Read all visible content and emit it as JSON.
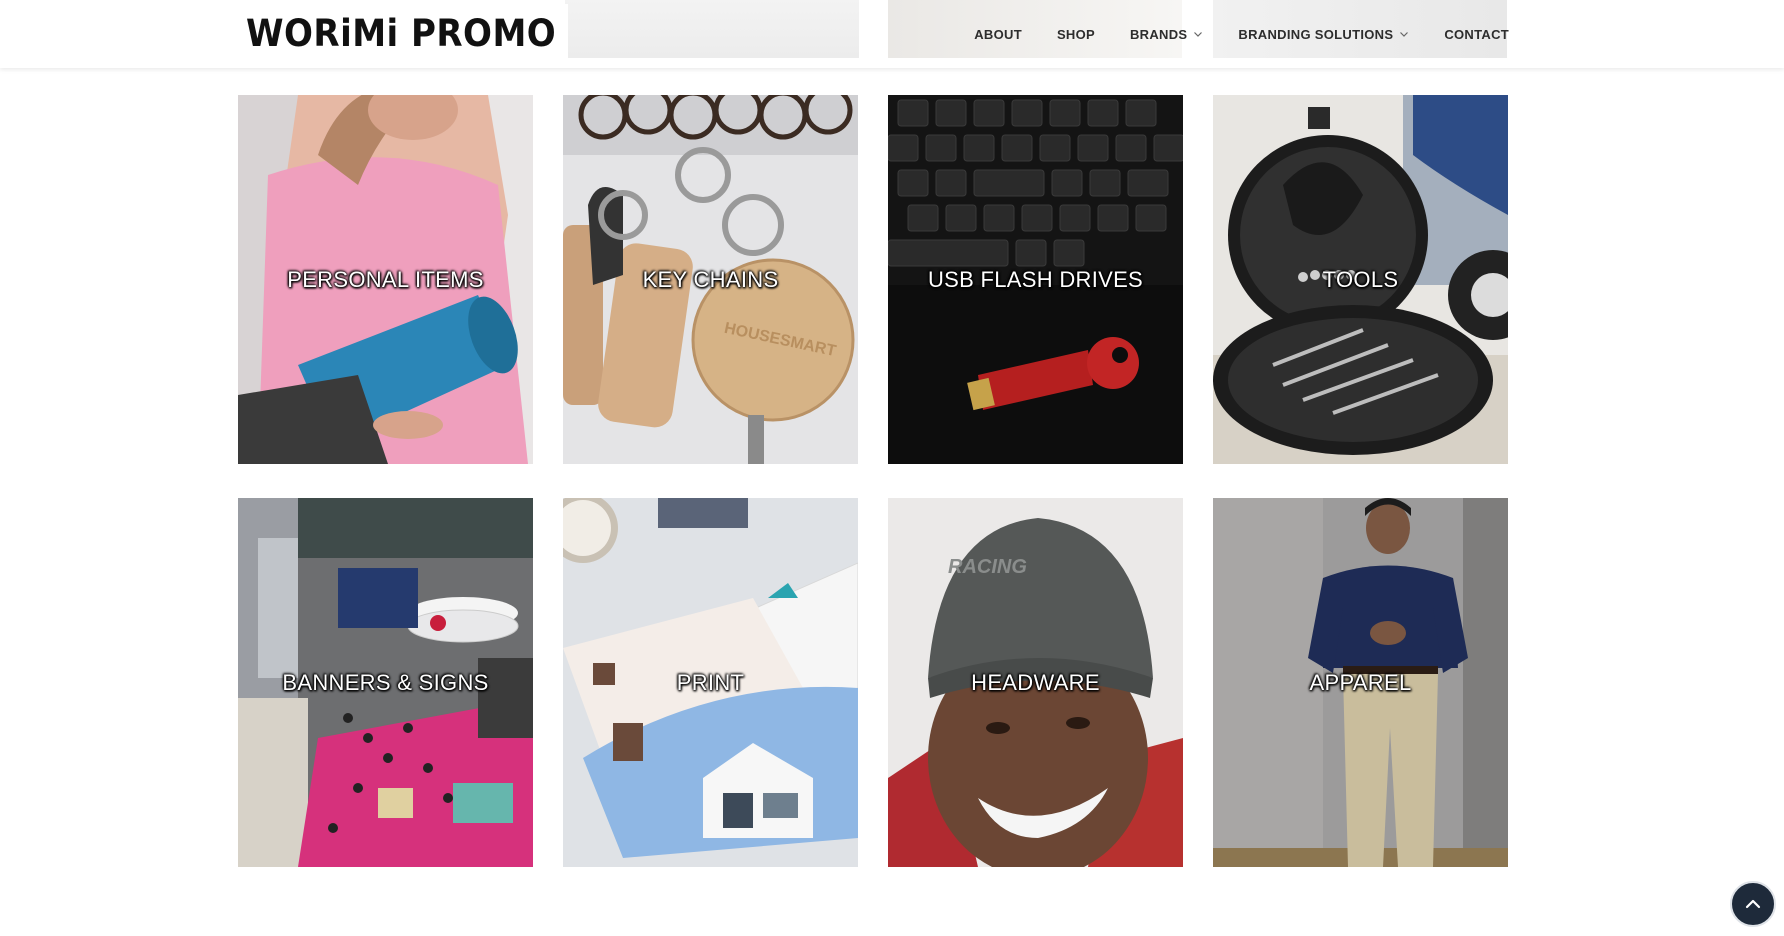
{
  "header": {
    "logo_text": "WORiMi PROMO",
    "nav": [
      {
        "label": "ABOUT",
        "has_dropdown": false
      },
      {
        "label": "SHOP",
        "has_dropdown": false
      },
      {
        "label": "BRANDS",
        "has_dropdown": true
      },
      {
        "label": "BRANDING SOLUTIONS",
        "has_dropdown": true
      },
      {
        "label": "CONTACT",
        "has_dropdown": false
      }
    ]
  },
  "categories": [
    {
      "label": "PERSONAL ITEMS"
    },
    {
      "label": "KEY CHAINS"
    },
    {
      "label": "USB FLASH DRIVES"
    },
    {
      "label": "TOOLS"
    },
    {
      "label": "BANNERS & SIGNS"
    },
    {
      "label": "PRINT"
    },
    {
      "label": "HEADWARE"
    },
    {
      "label": "APPAREL"
    }
  ],
  "scroll_top": {
    "icon": "chevron-up-icon"
  },
  "colors": {
    "nav_text": "#2d2d2d",
    "scroll_top_bg": "#1e2a3a"
  }
}
